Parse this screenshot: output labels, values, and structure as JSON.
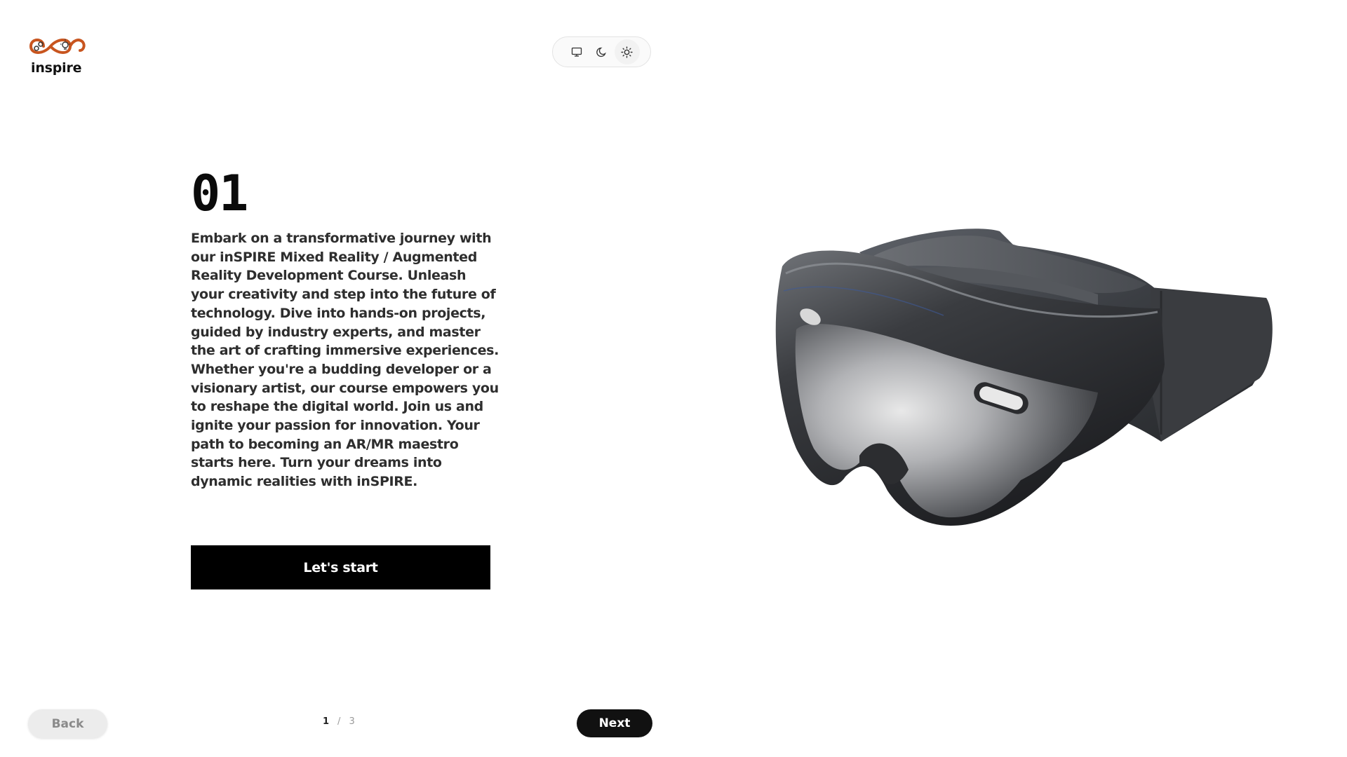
{
  "brand": {
    "logo_text": "inspire",
    "primary_color": "#c8551f"
  },
  "theme_switch": {
    "options": [
      {
        "icon": "monitor-icon",
        "label": "System"
      },
      {
        "icon": "moon-icon",
        "label": "Dark"
      },
      {
        "icon": "sun-icon",
        "label": "Light"
      }
    ],
    "active": "sun-icon"
  },
  "slide": {
    "number": "01",
    "description": "Embark on a transformative journey with our inSPIRE Mixed Reality / Augmented Reality Development Course. Unleash your creativity and step into the future of technology. Dive into hands-on projects, guided by industry experts, and master the art of crafting immersive experiences. Whether you're a budding developer or a visionary artist, our course empowers you to reshape the digital world. Join us and ignite your passion for innovation. Your path to becoming an AR/MR maestro starts here. Turn your dreams into dynamic realities with inSPIRE.",
    "cta_label": "Let's start",
    "image_icon": "vr-headset-image"
  },
  "navigation": {
    "back_label": "Back",
    "next_label": "Next",
    "current_page": "1",
    "separator": "/",
    "total_pages": "3"
  }
}
